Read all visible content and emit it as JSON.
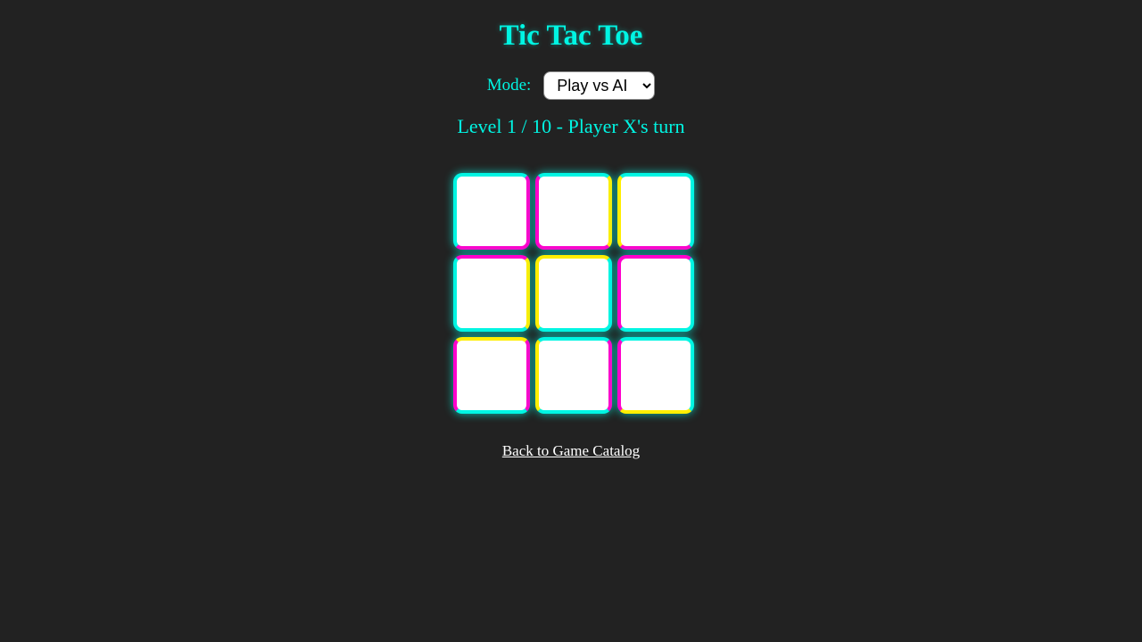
{
  "game": {
    "title": "Tic Tac Toe",
    "mode_label": "Mode:",
    "mode_selected": "Play vs AI",
    "mode_options": [
      "Play vs AI"
    ],
    "status": "Level 1 / 10 - Player X's turn",
    "back_link": "Back to Game Catalog"
  },
  "board": {
    "cells": [
      "",
      "",
      "",
      "",
      "",
      "",
      "",
      "",
      ""
    ],
    "cell_borders": [
      {
        "top": "#00f5e3",
        "right": "#ff00cc",
        "bottom": "#ff00cc",
        "left": "#00f5e3"
      },
      {
        "top": "#00f5e3",
        "right": "#ffee00",
        "bottom": "#ff00cc",
        "left": "#ff00cc"
      },
      {
        "top": "#00f5e3",
        "right": "#00f5e3",
        "bottom": "#ff00cc",
        "left": "#ffee00"
      },
      {
        "top": "#ff00cc",
        "right": "#ffee00",
        "bottom": "#00f5e3",
        "left": "#00f5e3"
      },
      {
        "top": "#ffee00",
        "right": "#00f5e3",
        "bottom": "#00f5e3",
        "left": "#ffee00"
      },
      {
        "top": "#ff00cc",
        "right": "#00f5e3",
        "bottom": "#00f5e3",
        "left": "#ff00cc"
      },
      {
        "top": "#ffee00",
        "right": "#ff00cc",
        "bottom": "#00f5e3",
        "left": "#ff00cc"
      },
      {
        "top": "#00f5e3",
        "right": "#ff00cc",
        "bottom": "#00f5e3",
        "left": "#ffee00"
      },
      {
        "top": "#00f5e3",
        "right": "#00f5e3",
        "bottom": "#ffee00",
        "left": "#ff00cc"
      }
    ]
  },
  "colors": {
    "background": "#222222",
    "accent_cyan": "#00f5e3",
    "accent_magenta": "#ff00cc",
    "accent_yellow": "#ffee00",
    "cell_fill": "#ffffff",
    "link": "#ffffff"
  }
}
